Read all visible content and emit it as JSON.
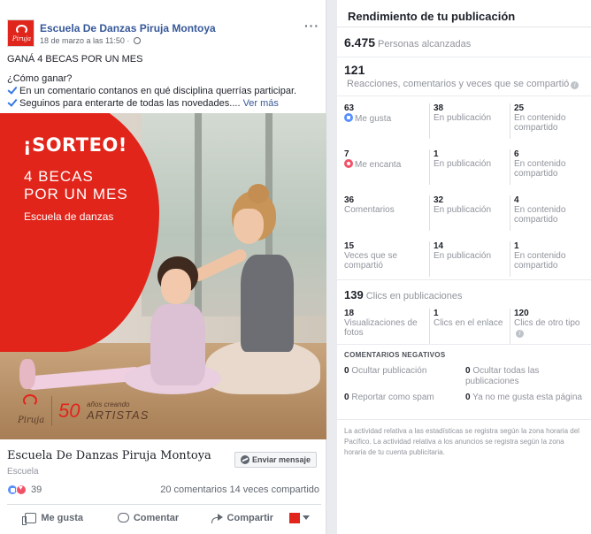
{
  "post": {
    "page_name": "Escuela De Danzas Piruja Montoya",
    "avatar_text": "Piruja",
    "meta": "18 de marzo a las 11:50 ·",
    "headline": "GANÁ 4 BECAS POR UN MES",
    "question": "¿Cómo ganar?",
    "step1": "En un comentario contanos en qué disciplina querrías participar.",
    "step2": "Seguinos para enterarte de todas las novedades....",
    "see_more": "Ver más",
    "image": {
      "title": "¡SORTEO!",
      "line1": "4 BECAS",
      "line2": "POR UN MES",
      "line3": "Escuela de danzas",
      "logo_word": "Piruja",
      "fifty": "50",
      "anios": "años creando",
      "artistas": "ARTISTAS"
    },
    "footer_name": "Escuela De Danzas Piruja Montoya",
    "footer_category": "Escuela",
    "send_message": "Enviar mensaje",
    "reaction_count": "39",
    "comments_shares": "20 comentarios  14 veces compartido",
    "actions": {
      "like": "Me gusta",
      "comment": "Comentar",
      "share": "Compartir"
    },
    "icons": [
      "globe-icon",
      "more-icon",
      "check-icon",
      "like-icon",
      "love-icon",
      "messenger-icon",
      "thumb-icon",
      "comment-icon",
      "share-icon",
      "caret-icon"
    ],
    "colors": {
      "link": "#365899",
      "brand_red": "#e1251b",
      "check": "#3578e5"
    }
  },
  "insights": {
    "title": "Rendimiento de tu publicación",
    "reach_value": "6.475",
    "reach_label": "Personas alcanzadas",
    "reactions_total": "121",
    "reactions_label": "Reacciones, comentarios y veces que se compartió",
    "rows": [
      {
        "a_num": "63",
        "a_txt": "Me gusta",
        "b_num": "38",
        "b_txt": "En publicación",
        "c_num": "25",
        "c_txt": "En contenido compartido"
      },
      {
        "a_num": "7",
        "a_txt": "Me encanta",
        "b_num": "1",
        "b_txt": "En publicación",
        "c_num": "6",
        "c_txt": "En contenido compartido"
      },
      {
        "a_num": "36",
        "a_txt": "Comentarios",
        "b_num": "32",
        "b_txt": "En publicación",
        "c_num": "4",
        "c_txt": "En contenido compartido"
      },
      {
        "a_num": "15",
        "a_txt": "Veces que se compartió",
        "b_num": "14",
        "b_txt": "En publicación",
        "c_num": "1",
        "c_txt": "En contenido compartido"
      }
    ],
    "clicks_value": "139",
    "clicks_label": "Clics en publicaciones",
    "clicks_row": {
      "a_num": "18",
      "a_txt": "Visualizaciones de fotos",
      "b_num": "1",
      "b_txt": "Clics en el enlace",
      "c_num": "120",
      "c_txt": "Clics de otro tipo"
    },
    "negative_title": "COMENTARIOS NEGATIVOS",
    "negative": [
      {
        "num": "0",
        "txt": "Ocultar publicación"
      },
      {
        "num": "0",
        "txt": "Ocultar todas las publicaciones"
      },
      {
        "num": "0",
        "txt": "Reportar como spam"
      },
      {
        "num": "0",
        "txt": "Ya no me gusta esta página"
      }
    ],
    "footnote": "La actividad relativa a las estadísticas se registra según la zona horaria del Pacífico. La actividad relativa a los anuncios se registra según la zona horaria de tu cuenta publicitaria."
  }
}
